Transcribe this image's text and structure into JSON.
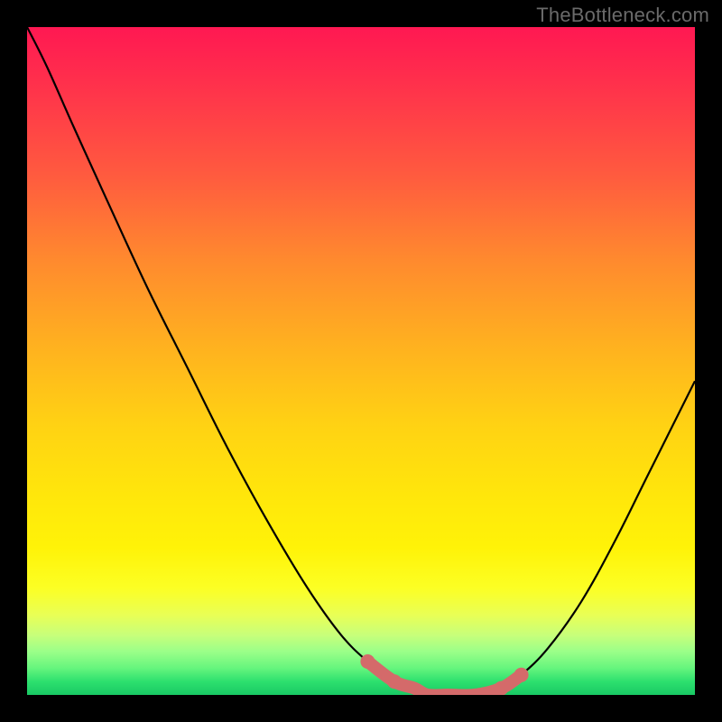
{
  "watermark": "TheBottleneck.com",
  "chart_data": {
    "type": "line",
    "title": "",
    "xlabel": "",
    "ylabel": "",
    "x": [
      0.0,
      0.03,
      0.07,
      0.12,
      0.18,
      0.24,
      0.3,
      0.36,
      0.42,
      0.47,
      0.51,
      0.55,
      0.58,
      0.6,
      0.63,
      0.67,
      0.71,
      0.74,
      0.78,
      0.83,
      0.88,
      0.93,
      1.0
    ],
    "values": [
      1.0,
      0.94,
      0.85,
      0.74,
      0.61,
      0.49,
      0.37,
      0.26,
      0.16,
      0.09,
      0.05,
      0.02,
      0.01,
      0.0,
      0.0,
      0.0,
      0.01,
      0.03,
      0.07,
      0.14,
      0.23,
      0.33,
      0.47
    ],
    "xlim": [
      0,
      1
    ],
    "ylim": [
      0,
      1
    ],
    "marker_range_x": [
      0.51,
      0.74
    ],
    "marker_color": "#d46a6a",
    "curve_color": "#000000"
  }
}
